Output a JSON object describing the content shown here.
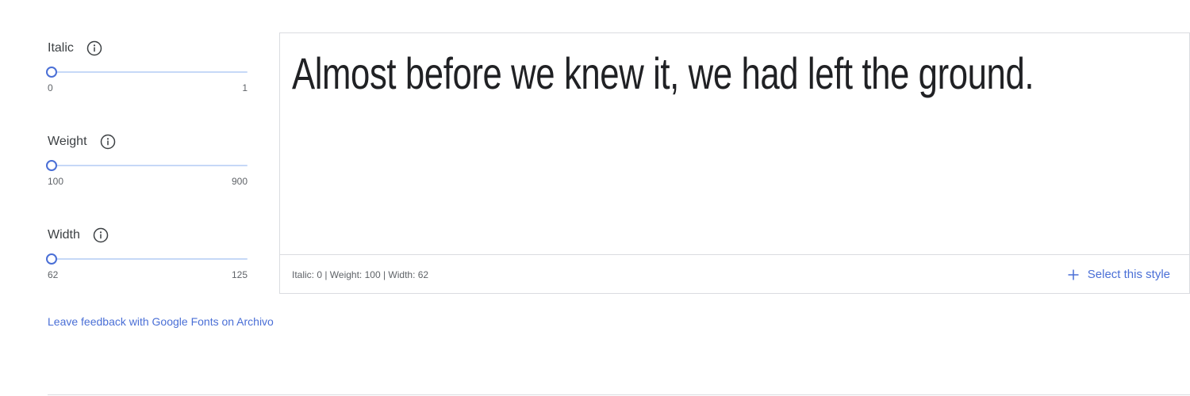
{
  "axes": [
    {
      "label": "Italic",
      "min": "0",
      "max": "1",
      "value": 0,
      "info_icon": "info-circle-icon"
    },
    {
      "label": "Weight",
      "min": "100",
      "max": "900",
      "value": 100,
      "info_icon": "info-circle-icon"
    },
    {
      "label": "Width",
      "min": "62",
      "max": "125",
      "value": 62,
      "info_icon": "info-circle-icon"
    }
  ],
  "feedback_link": "Leave feedback with Google Fonts on Archivo",
  "preview": {
    "sample_text": "Almost before we knew it, we had left the ground.",
    "style_summary": "Italic: 0 | Weight: 100 | Width: 62",
    "select_label": "Select this style",
    "select_icon": "plus-icon"
  },
  "colors": {
    "accent": "#4a6fd6",
    "track": "#c6d8f7",
    "border": "#dadce0",
    "text": "#3c4043"
  }
}
